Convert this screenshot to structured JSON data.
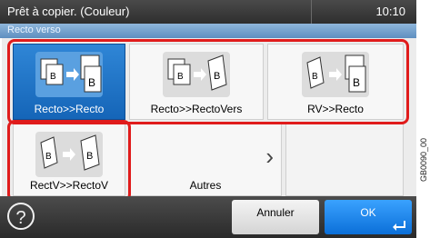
{
  "status": {
    "mode_text": "Prêt à copier. (Couleur)",
    "time": "10:10"
  },
  "title": "Recto verso",
  "options": [
    {
      "id": "recto-recto",
      "label": "Recto>>Recto",
      "selected": true,
      "icon": "recto-recto-icon"
    },
    {
      "id": "recto-rectovers",
      "label": "Recto>>RectoVers",
      "selected": false,
      "icon": "recto-rectovers-icon"
    },
    {
      "id": "rv-recto",
      "label": "RV>>Recto",
      "selected": false,
      "icon": "rv-recto-icon"
    },
    {
      "id": "rectv-rectov",
      "label": "RectV>>RectoV",
      "selected": false,
      "icon": "rectv-rectov-icon"
    },
    {
      "id": "autres",
      "label": "Autres",
      "selected": false,
      "icon": "chevron-right-icon"
    }
  ],
  "bottom": {
    "help_label": "?",
    "cancel_label": "Annuler",
    "ok_label": "OK"
  },
  "side_code": "GB0090_00",
  "colors": {
    "selected": "#1565b8",
    "highlight_outline": "#e01b1b"
  }
}
